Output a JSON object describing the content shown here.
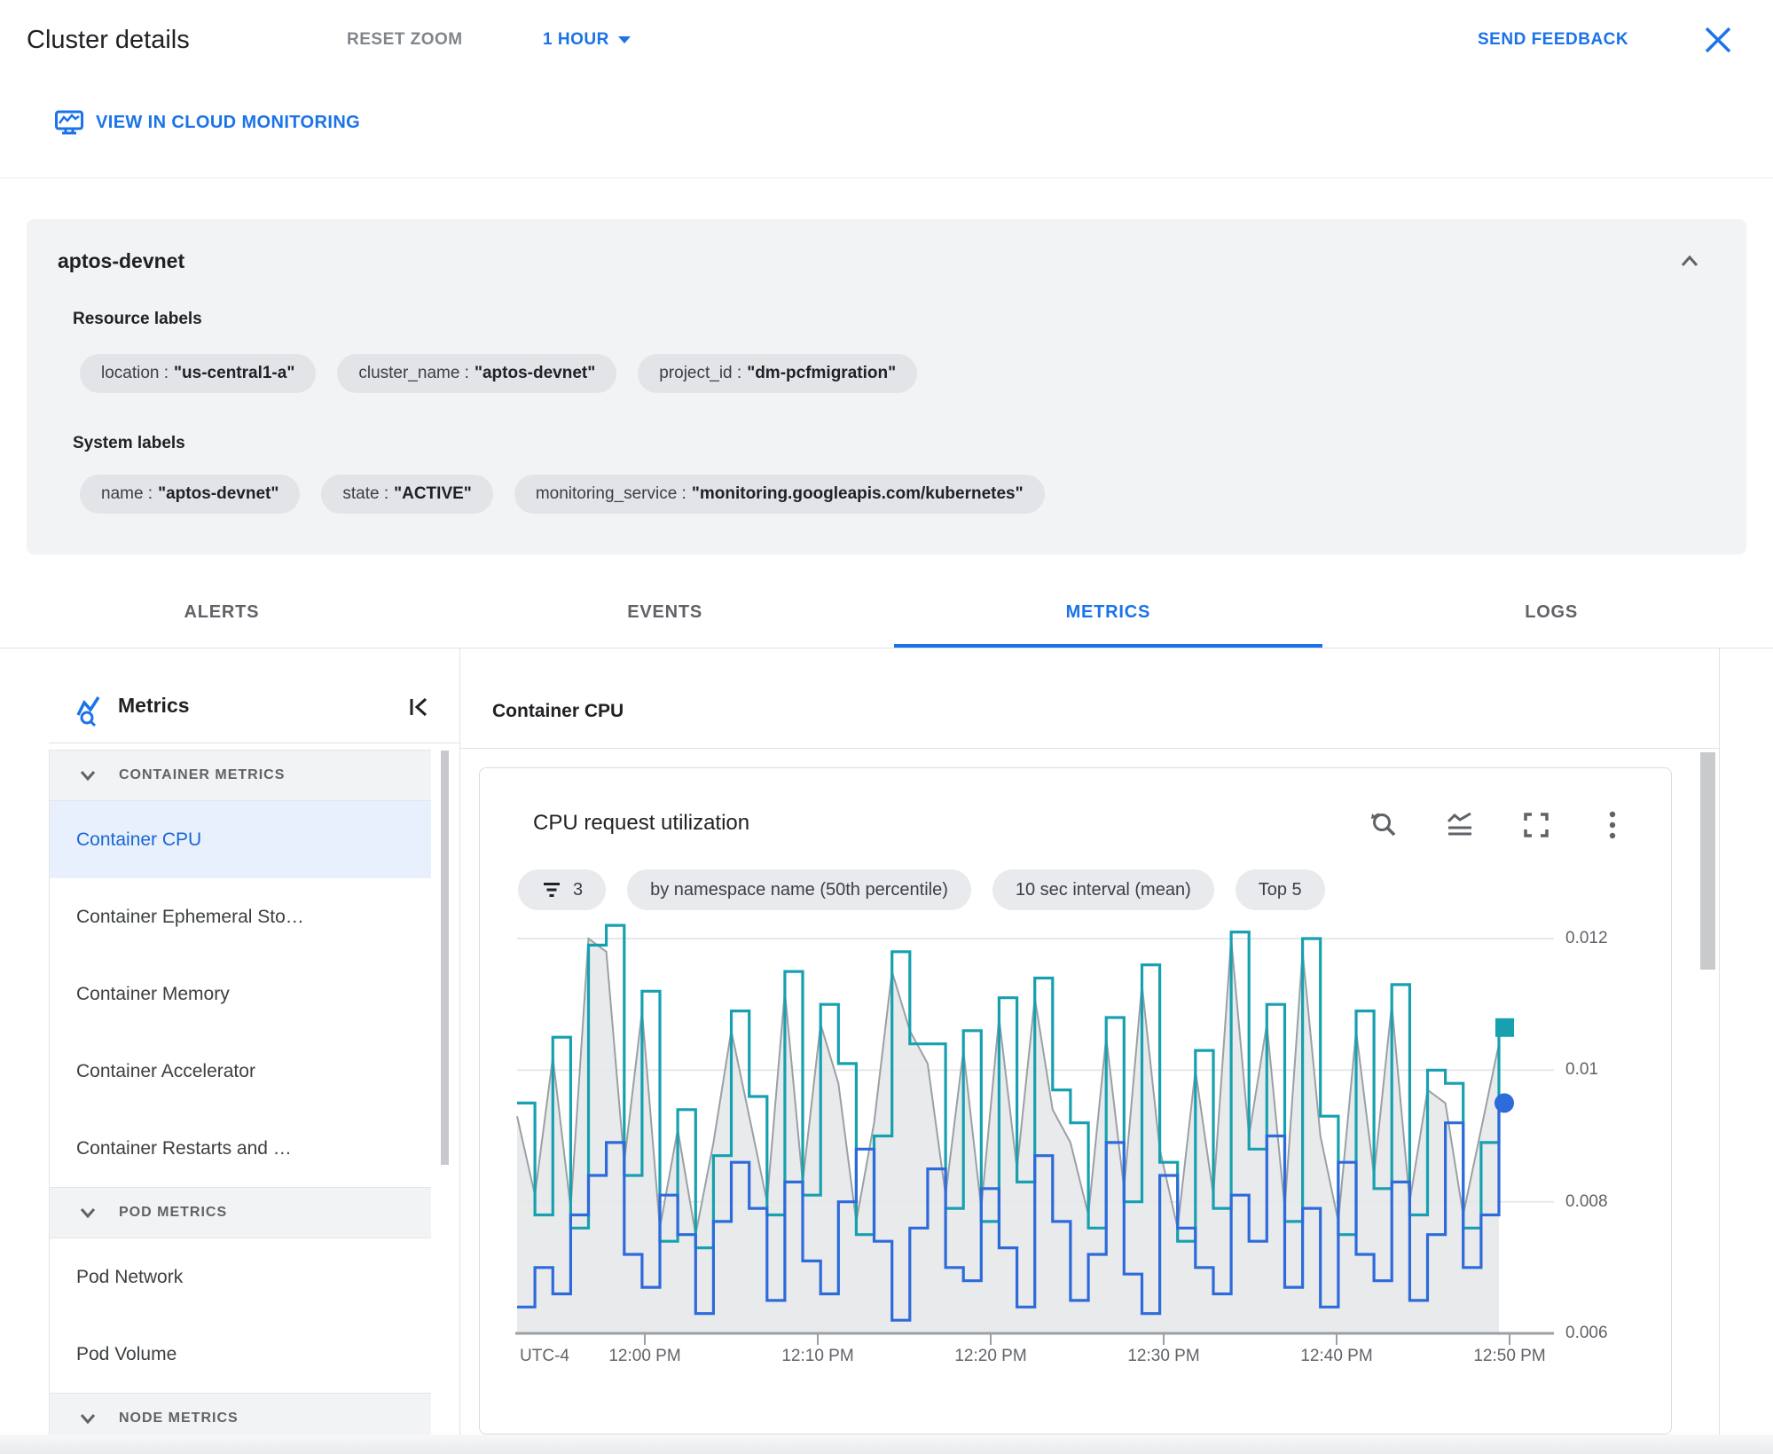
{
  "header": {
    "title": "Cluster details",
    "reset_zoom": "RESET ZOOM",
    "time_range": "1 HOUR",
    "send_feedback": "SEND FEEDBACK"
  },
  "toolbar": {
    "view_in_cloud_monitoring": "VIEW IN CLOUD MONITORING"
  },
  "cluster_card": {
    "name": "aptos-devnet",
    "resource_labels_title": "Resource labels",
    "resource_labels": [
      {
        "key": "location",
        "value": "\"us-central1-a\""
      },
      {
        "key": "cluster_name",
        "value": "\"aptos-devnet\""
      },
      {
        "key": "project_id",
        "value": "\"dm-pcfmigration\""
      }
    ],
    "system_labels_title": "System labels",
    "system_labels": [
      {
        "key": "name",
        "value": "\"aptos-devnet\""
      },
      {
        "key": "state",
        "value": "\"ACTIVE\""
      },
      {
        "key": "monitoring_service",
        "value": "\"monitoring.googleapis.com/kubernetes\""
      }
    ]
  },
  "tabs": [
    {
      "label": "ALERTS",
      "active": false
    },
    {
      "label": "EVENTS",
      "active": false
    },
    {
      "label": "METRICS",
      "active": true
    },
    {
      "label": "LOGS",
      "active": false
    }
  ],
  "sidebar": {
    "title": "Metrics",
    "sections": [
      {
        "header": "CONTAINER METRICS",
        "items": [
          {
            "label": "Container CPU",
            "selected": true
          },
          {
            "label": "Container Ephemeral Sto…",
            "selected": false
          },
          {
            "label": "Container Memory",
            "selected": false
          },
          {
            "label": "Container Accelerator",
            "selected": false
          },
          {
            "label": "Container Restarts and …",
            "selected": false
          }
        ]
      },
      {
        "header": "POD METRICS",
        "items": [
          {
            "label": "Pod Network",
            "selected": false
          },
          {
            "label": "Pod Volume",
            "selected": false
          }
        ]
      },
      {
        "header": "NODE METRICS",
        "items": []
      }
    ]
  },
  "main": {
    "panel_title": "Container CPU",
    "chart_card": {
      "title": "CPU request utilization",
      "filter_chips": [
        {
          "icon": "filter",
          "label": "3"
        },
        {
          "icon": "",
          "label": "by namespace name (50th percentile)"
        },
        {
          "icon": "",
          "label": "10 sec interval (mean)"
        },
        {
          "icon": "",
          "label": "Top 5"
        }
      ]
    }
  },
  "chart_data": {
    "type": "line",
    "title": "CPU request utilization",
    "xlabel": "",
    "ylabel": "",
    "x_tick_labels": [
      "UTC-4",
      "12:00 PM",
      "12:10 PM",
      "12:20 PM",
      "12:30 PM",
      "12:40 PM",
      "12:50 PM"
    ],
    "y_tick_labels": [
      "0.012",
      "0.01",
      "0.008",
      "0.006"
    ],
    "y_gridlines": [
      0.012,
      0.01,
      0.008
    ],
    "ylim": [
      0.006,
      0.0122
    ],
    "grid": true,
    "legend": "none",
    "series": [
      {
        "name": "gray-area-series",
        "style": "area-linear",
        "color": "#9aa0a6",
        "fill": "#e5e6e7",
        "end_marker": "",
        "values": [
          0.0093,
          0.0081,
          0.0102,
          0.0079,
          0.012,
          0.0118,
          0.0086,
          0.0109,
          0.0076,
          0.0091,
          0.0075,
          0.0089,
          0.0106,
          0.0093,
          0.008,
          0.0112,
          0.0083,
          0.0107,
          0.0098,
          0.0077,
          0.0092,
          0.0115,
          0.0106,
          0.0101,
          0.0081,
          0.0103,
          0.0079,
          0.0108,
          0.0085,
          0.0111,
          0.0094,
          0.0089,
          0.0078,
          0.0105,
          0.0082,
          0.0113,
          0.0088,
          0.0076,
          0.01,
          0.0081,
          0.012,
          0.009,
          0.0107,
          0.0079,
          0.0118,
          0.009,
          0.0077,
          0.0106,
          0.0084,
          0.011,
          0.008,
          0.0097,
          0.0095,
          0.0078,
          0.0091,
          0.0104
        ]
      },
      {
        "name": "teal-step-series",
        "style": "step",
        "color": "#17a0b0",
        "fill": "",
        "end_marker": "square",
        "values": [
          0.0095,
          0.0078,
          0.0105,
          0.0076,
          0.0119,
          0.0122,
          0.0084,
          0.0112,
          0.0074,
          0.0094,
          0.0073,
          0.0087,
          0.0109,
          0.0096,
          0.0078,
          0.0115,
          0.0081,
          0.011,
          0.0101,
          0.0075,
          0.009,
          0.0118,
          0.0104,
          0.0104,
          0.0079,
          0.0106,
          0.0077,
          0.0111,
          0.0083,
          0.0114,
          0.0097,
          0.0092,
          0.0076,
          0.0108,
          0.008,
          0.0116,
          0.0086,
          0.0074,
          0.0103,
          0.0079,
          0.0121,
          0.0088,
          0.011,
          0.0077,
          0.012,
          0.0093,
          0.0075,
          0.0109,
          0.0082,
          0.0113,
          0.0078,
          0.01,
          0.0098,
          0.0076,
          0.0089,
          0.0106
        ]
      },
      {
        "name": "blue-step-series",
        "style": "step",
        "color": "#2d6bdb",
        "fill": "",
        "end_marker": "circle",
        "values": [
          0.0064,
          0.007,
          0.0066,
          0.0078,
          0.0084,
          0.0089,
          0.0072,
          0.0067,
          0.0081,
          0.0075,
          0.0063,
          0.0077,
          0.0086,
          0.0079,
          0.0065,
          0.0083,
          0.0071,
          0.0066,
          0.008,
          0.0088,
          0.0074,
          0.0062,
          0.0076,
          0.0085,
          0.007,
          0.0068,
          0.0082,
          0.0073,
          0.0064,
          0.0087,
          0.0077,
          0.0065,
          0.0072,
          0.0089,
          0.0069,
          0.0063,
          0.0084,
          0.0076,
          0.007,
          0.0066,
          0.0081,
          0.0074,
          0.009,
          0.0067,
          0.0079,
          0.0064,
          0.0086,
          0.0072,
          0.0068,
          0.0083,
          0.0065,
          0.0075,
          0.0092,
          0.007,
          0.0078,
          0.0095
        ]
      }
    ]
  },
  "colors": {
    "accent": "#1a73e8",
    "selected_text": "#1967d2",
    "selected_bg": "#e8f0fe",
    "card_bg": "#f1f3f4",
    "chip_bg": "#e2e4e7",
    "teal_series": "#17a0b0",
    "blue_series": "#2d6bdb",
    "gray_series": "#9aa0a6"
  }
}
